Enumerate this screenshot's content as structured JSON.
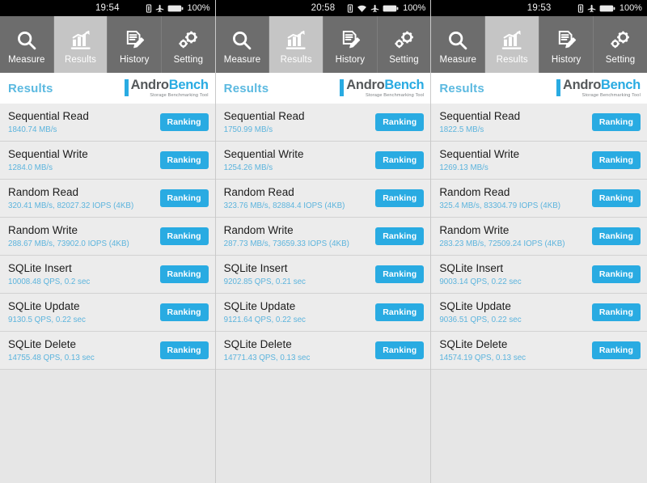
{
  "app": {
    "name": "AndroBench",
    "logo_primary": "Andro",
    "logo_secondary": "Bench",
    "tagline": "Storage Benchmarking Tool",
    "accent_color": "#29abe2",
    "value_color": "#5cb4dd",
    "tabbar_color": "#6d6d6d",
    "tabbar_active_color": "#c5c5c5",
    "row_color": "#ececec"
  },
  "header": {
    "title": "Results"
  },
  "tabs": [
    {
      "label": "Measure",
      "icon": "magnifier-icon",
      "active": false
    },
    {
      "label": "Results",
      "icon": "bar-chart-icon",
      "active": true
    },
    {
      "label": "History",
      "icon": "document-pen-icon",
      "active": false
    },
    {
      "label": "Setting",
      "icon": "gears-icon",
      "active": false
    }
  ],
  "ranking_label": "Ranking",
  "screens": [
    {
      "status": {
        "time": "19:54",
        "battery_percent": "100%",
        "icons": [
          "vibrate-icon",
          "airplane-mode-icon",
          "battery-full-icon"
        ]
      },
      "results": [
        {
          "name": "Sequential Read",
          "value": "1840.74 MB/s"
        },
        {
          "name": "Sequential Write",
          "value": "1284.0 MB/s"
        },
        {
          "name": "Random Read",
          "value": "320.41 MB/s, 82027.32 IOPS (4KB)"
        },
        {
          "name": "Random Write",
          "value": "288.67 MB/s, 73902.0 IOPS (4KB)"
        },
        {
          "name": "SQLite Insert",
          "value": "10008.48 QPS, 0.2 sec"
        },
        {
          "name": "SQLite Update",
          "value": "9130.5 QPS, 0.22 sec"
        },
        {
          "name": "SQLite Delete",
          "value": "14755.48 QPS, 0.13 sec"
        }
      ]
    },
    {
      "status": {
        "time": "20:58",
        "battery_percent": "100%",
        "icons": [
          "vibrate-icon",
          "wifi-icon",
          "airplane-mode-icon",
          "battery-full-icon"
        ]
      },
      "results": [
        {
          "name": "Sequential Read",
          "value": "1750.99 MB/s"
        },
        {
          "name": "Sequential Write",
          "value": "1254.26 MB/s"
        },
        {
          "name": "Random Read",
          "value": "323.76 MB/s, 82884.4 IOPS (4KB)"
        },
        {
          "name": "Random Write",
          "value": "287.73 MB/s, 73659.33 IOPS (4KB)"
        },
        {
          "name": "SQLite Insert",
          "value": "9202.85 QPS, 0.21 sec"
        },
        {
          "name": "SQLite Update",
          "value": "9121.64 QPS, 0.22 sec"
        },
        {
          "name": "SQLite Delete",
          "value": "14771.43 QPS, 0.13 sec"
        }
      ]
    },
    {
      "status": {
        "time": "19:53",
        "battery_percent": "100%",
        "icons": [
          "vibrate-icon",
          "airplane-mode-icon",
          "battery-full-icon"
        ]
      },
      "results": [
        {
          "name": "Sequential Read",
          "value": "1822.5 MB/s"
        },
        {
          "name": "Sequential Write",
          "value": "1269.13 MB/s"
        },
        {
          "name": "Random Read",
          "value": "325.4 MB/s, 83304.79 IOPS (4KB)"
        },
        {
          "name": "Random Write",
          "value": "283.23 MB/s, 72509.24 IOPS (4KB)"
        },
        {
          "name": "SQLite Insert",
          "value": "9003.14 QPS, 0.22 sec"
        },
        {
          "name": "SQLite Update",
          "value": "9036.51 QPS, 0.22 sec"
        },
        {
          "name": "SQLite Delete",
          "value": "14574.19 QPS, 0.13 sec"
        }
      ]
    }
  ]
}
